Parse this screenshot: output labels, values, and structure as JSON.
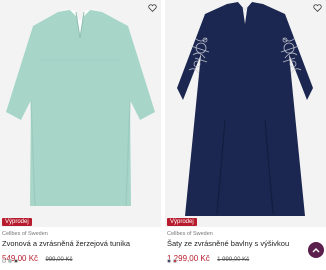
{
  "products": [
    {
      "badge": "Výprodej",
      "brand": "Cellbes of Sweden",
      "title": "Zvonová a zvrásněná žerzejová tunika",
      "price": "549,00 Kč",
      "old_price": "999,00 Kč",
      "swatches": [
        "#ffffff",
        "#9ac6bb",
        "#2a2a2a"
      ]
    },
    {
      "badge": "Výprodej",
      "brand": "Cellbes of Sweden",
      "title": "Šaty ze zvrásněné bavlny s výšivkou",
      "price": "1 299,00 Kč",
      "old_price": "1 999,00 Kč",
      "swatches": [
        "#1c2650",
        "#b71c2e"
      ]
    }
  ],
  "icons": {
    "favorite": "heart-outline-icon",
    "scroll_top": "chevron-up-icon"
  },
  "colors": {
    "sale": "#b71c2e",
    "scroll_button": "#5b1f4e",
    "tunic": "#a7d6c9",
    "dress": "#1b2750"
  }
}
